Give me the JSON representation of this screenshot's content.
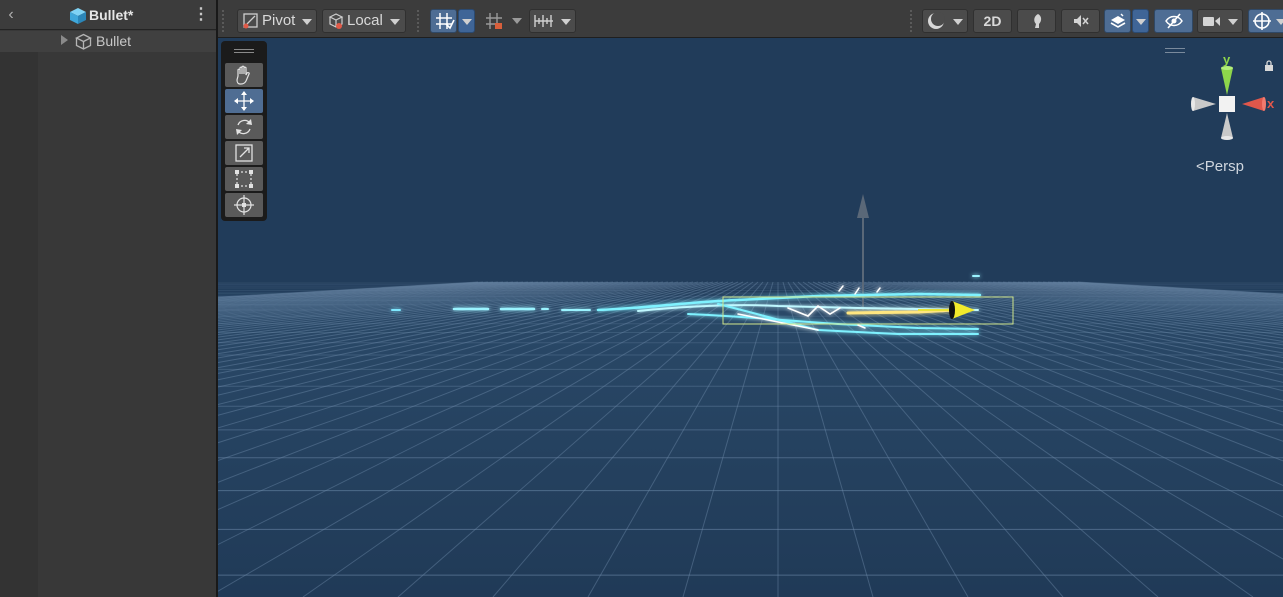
{
  "hierarchy": {
    "back_icon": "chevron-left-icon",
    "title": "Bullet*",
    "title_icon": "prefab-cube-icon",
    "menu_icon": "kebab-menu-icon",
    "items": [
      {
        "label": "Bullet",
        "icon": "gameobject-cube-icon",
        "expanded": false
      }
    ]
  },
  "toolbar": {
    "pivot_label": "Pivot",
    "local_label": "Local",
    "mode_2d_label": "2D",
    "icons": {
      "pivot": "pivot-icon",
      "local": "local-space-icon",
      "grid_snap": "grid-snap-icon",
      "grid_visibility": "grid-visibility-icon",
      "increment_snap": "increment-snap-icon",
      "draw_mode": "shading-mode-icon",
      "lighting": "lighting-icon",
      "audio": "audio-mute-icon",
      "effects": "effects-icon",
      "hidden_objects": "hidden-objects-icon",
      "camera": "scene-camera-icon",
      "gizmos": "gizmos-icon"
    }
  },
  "tools": [
    {
      "name": "hand-tool",
      "icon": "hand-icon",
      "active": false
    },
    {
      "name": "move-tool",
      "icon": "move-icon",
      "active": true
    },
    {
      "name": "rotate-tool",
      "icon": "rotate-icon",
      "active": false
    },
    {
      "name": "scale-tool",
      "icon": "scale-icon",
      "active": false
    },
    {
      "name": "rect-tool",
      "icon": "rect-transform-icon",
      "active": false
    },
    {
      "name": "transform-tool",
      "icon": "transform-icon",
      "active": false
    }
  ],
  "gizmo": {
    "axis_y": "y",
    "axis_x": "x",
    "projection_label": "Persp",
    "colors": {
      "y": "#8ed64b",
      "x": "#e0574b",
      "neutral": "#c9c9c9"
    }
  },
  "colors": {
    "scene_bg": "#213c5a",
    "grid": "#6c89a8",
    "accent_blue": "#4e6d94",
    "effect_glow": "#6ff0ff"
  }
}
